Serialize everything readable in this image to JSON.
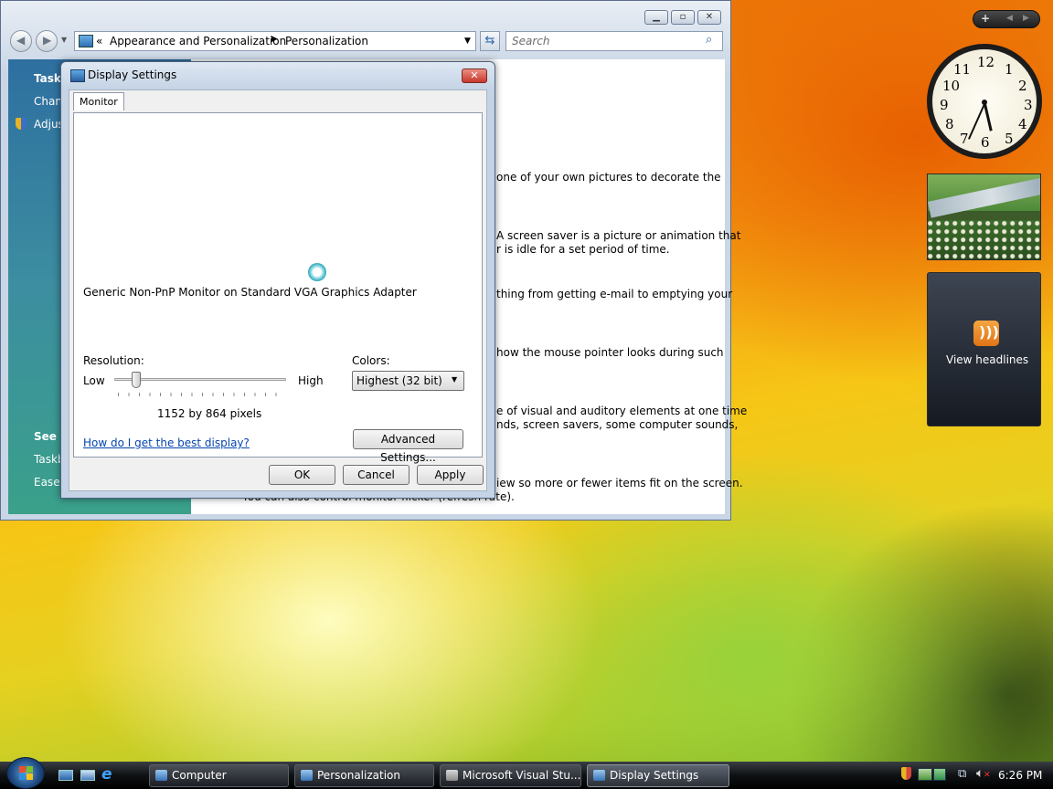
{
  "explorer": {
    "breadcrumb": {
      "chevrons": "«",
      "part1": "Appearance and Personalization",
      "part2": "Personalization"
    },
    "search_placeholder": "Search",
    "left_pane": {
      "tasks_heading": "Tasks",
      "items": [
        "Chang",
        "Adjus"
      ],
      "see_also_heading": "See a",
      "see_also_items": [
        "Taskb",
        "Ease c"
      ]
    },
    "content_lines": [
      "one of your own pictures to decorate the",
      "A screen saver is a picture or animation that",
      "r is idle for a set period of time.",
      "thing from getting e-mail to emptying your",
      "how the mouse pointer looks during such",
      "e of visual and auditory elements at one time",
      "nds, screen savers, some computer sounds,",
      "iew so more or fewer items fit on the screen.",
      "You can also control monitor flicker (refresh rate)."
    ]
  },
  "dialog": {
    "title": "Display Settings",
    "tab_label": "Monitor",
    "monitor_name": "Generic Non-PnP Monitor on Standard VGA Graphics Adapter",
    "resolution_label": "Resolution:",
    "low_label": "Low",
    "high_label": "High",
    "resolution_value": "1152 by 864 pixels",
    "resolution_slider_level": 0.1,
    "colors_label": "Colors:",
    "colors_value": "Highest (32 bit)",
    "help_link": "How do I get the best display?",
    "advanced_button": "Advanced Settings...",
    "ok_button": "OK",
    "cancel_button": "Cancel",
    "apply_button": "Apply"
  },
  "gadgets": {
    "clock_numbers": [
      "12",
      "1",
      "2",
      "3",
      "4",
      "5",
      "6",
      "7",
      "8",
      "9",
      "10",
      "11"
    ],
    "clock_time": "6:26",
    "feed_label": "View headlines"
  },
  "taskbar": {
    "buttons": [
      "Computer",
      "Personalization",
      "Microsoft Visual Stu...",
      "Display Settings"
    ],
    "active_button": "Display Settings",
    "clock": "6:26 PM"
  },
  "colors": {
    "accent": "#2e6fa0",
    "feed_icon": "#f08a24",
    "close_button": "#d9483b"
  }
}
